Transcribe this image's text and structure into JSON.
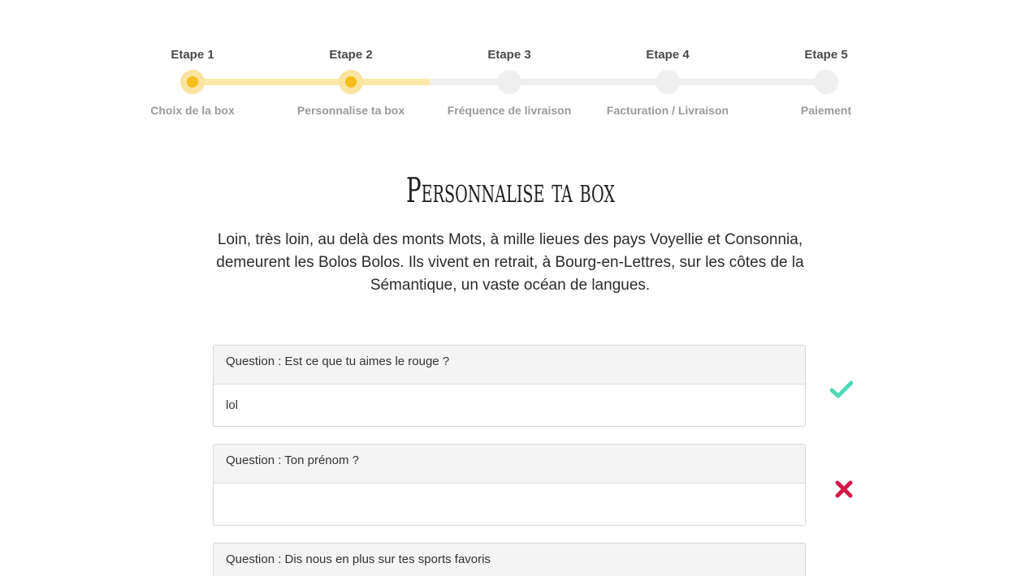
{
  "stepper": {
    "steps": [
      {
        "title": "Etape 1",
        "label": "Choix de la box",
        "done": true
      },
      {
        "title": "Etape 2",
        "label": "Personnalise ta box",
        "done": true
      },
      {
        "title": "Etape 3",
        "label": "Fréquence de livraison",
        "done": false
      },
      {
        "title": "Etape 4",
        "label": "Facturation / Livraison",
        "done": false
      },
      {
        "title": "Etape 5",
        "label": "Paiement",
        "done": false
      }
    ],
    "accent_color": "#f5be1a"
  },
  "main": {
    "title": "Personnalise ta box",
    "intro": "Loin, très loin, au delà des monts Mots, à mille lieues des pays Voyellie et Consonnia, demeurent les Bolos Bolos. Ils vivent en retrait, à Bourg-en-Lettres, sur les côtes de la Sémantique, un vaste océan de langues."
  },
  "questions": [
    {
      "label": "Question : Est ce que tu aimes le rouge ?",
      "value": "lol",
      "status": "valid",
      "status_icon": "check-icon",
      "status_color": "#4fd8b4"
    },
    {
      "label": "Question : Ton prénom ?",
      "value": "",
      "status": "invalid",
      "status_icon": "cross-icon",
      "status_color": "#d6174a"
    },
    {
      "label": "Question : Dis nous en plus sur tes sports favoris",
      "value": ""
    }
  ]
}
